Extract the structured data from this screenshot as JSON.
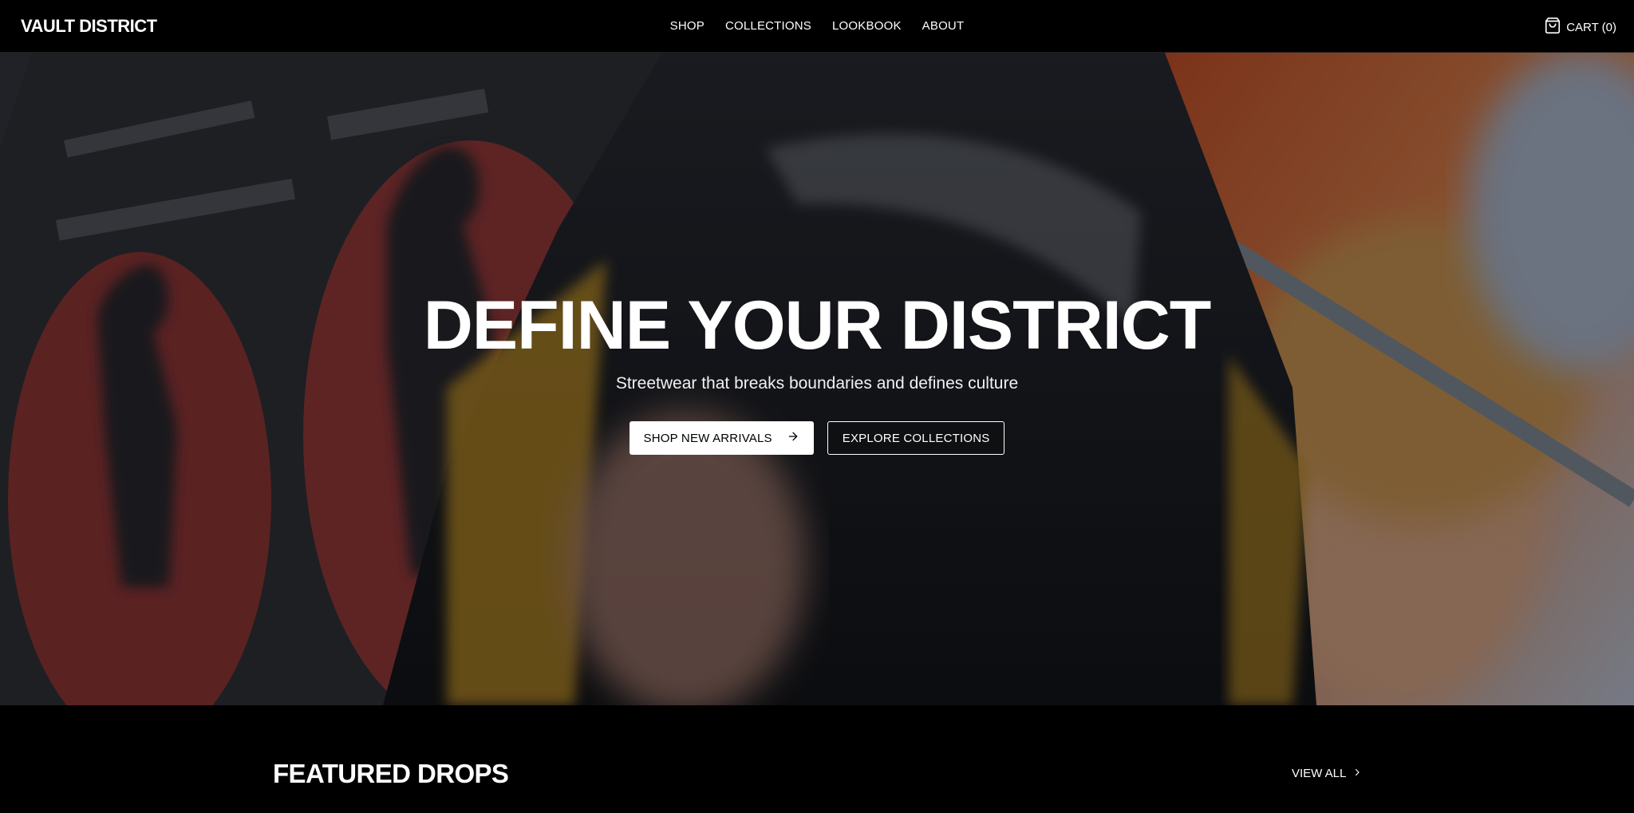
{
  "brand": {
    "logo": "VAULT DISTRICT"
  },
  "nav": {
    "links": [
      "SHOP",
      "COLLECTIONS",
      "LOOKBOOK",
      "ABOUT"
    ],
    "cart_label": "CART (0)",
    "cart_icon": "shopping-bag-icon"
  },
  "hero": {
    "title": "DEFINE YOUR DISTRICT",
    "subtitle": "Streetwear that breaks boundaries and defines culture",
    "primary_cta": "SHOP NEW ARRIVALS",
    "primary_cta_icon": "arrow-right-icon",
    "secondary_cta": "EXPLORE COLLECTIONS"
  },
  "featured": {
    "title": "FEATURED DROPS",
    "view_all": "VIEW ALL",
    "view_all_icon": "chevron-right-icon"
  },
  "colors": {
    "background": "#000000",
    "text": "#ffffff",
    "primary_button_bg": "#ffffff",
    "primary_button_text": "#000000"
  }
}
